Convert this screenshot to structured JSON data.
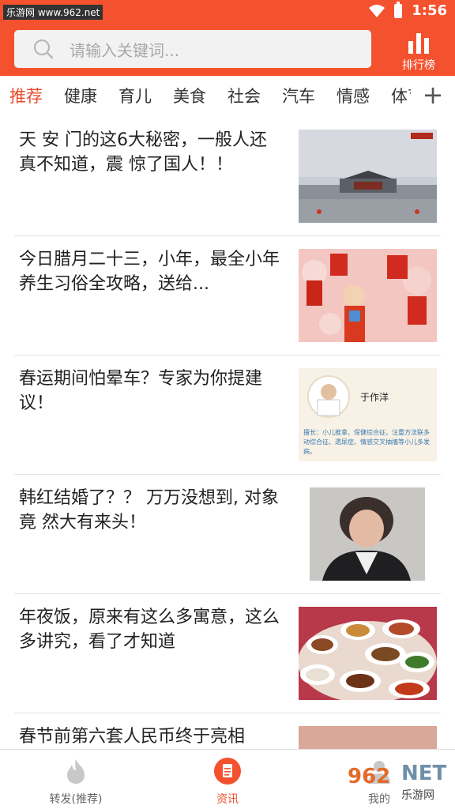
{
  "status": {
    "watermark": "乐游网 www.962.net",
    "time": "1:56"
  },
  "header": {
    "search_placeholder": "请输入关键词...",
    "rank_label": "排行榜"
  },
  "tabs": [
    {
      "label": "推荐",
      "active": true
    },
    {
      "label": "健康"
    },
    {
      "label": "育儿"
    },
    {
      "label": "美食"
    },
    {
      "label": "社会"
    },
    {
      "label": "汽车"
    },
    {
      "label": "情感"
    },
    {
      "label": "体育"
    }
  ],
  "tab_add": "+",
  "news": [
    {
      "title": "天 安 门的这6大秘密，一般人还真不知道，震 惊了国人！！",
      "thumb": "tiananmen-photo"
    },
    {
      "title": "今日腊月二十三，小年，最全小年养生习俗全攻略，送给...",
      "thumb": "new-year-child-photo"
    },
    {
      "title": "春运期间怕晕车？专家为你提建议！",
      "thumb": "doctor-card-image",
      "thumb_name": "于作洋",
      "thumb_caption": "擅长：小儿推拿、保健综合征，注重方法联多动综合征、遗尿症、情感交叉抽搐等小儿多发病。"
    },
    {
      "title": "韩红结婚了？？ 万万没想到, 对象竟 然大有来头！",
      "thumb": "portrait-photo"
    },
    {
      "title": "年夜饭，原来有这么多寓意，这么多讲究，看了才知道",
      "thumb": "dinner-table-photo"
    },
    {
      "title": "春节前第六套人民币终于亮相",
      "thumb": "currency-photo"
    }
  ],
  "bottom_nav": {
    "items": [
      {
        "label": "转发(推荐)",
        "icon": "flame-icon"
      },
      {
        "label": "资讯",
        "icon": "document-icon",
        "active": true
      },
      {
        "label": "我的",
        "icon": "user-icon"
      }
    ]
  },
  "watermark_bottom": {
    "brand": "962",
    "net": "NET",
    "cn": "乐游网"
  },
  "colors": {
    "brand": "#f4512f",
    "active_tab": "#e84a2e"
  }
}
